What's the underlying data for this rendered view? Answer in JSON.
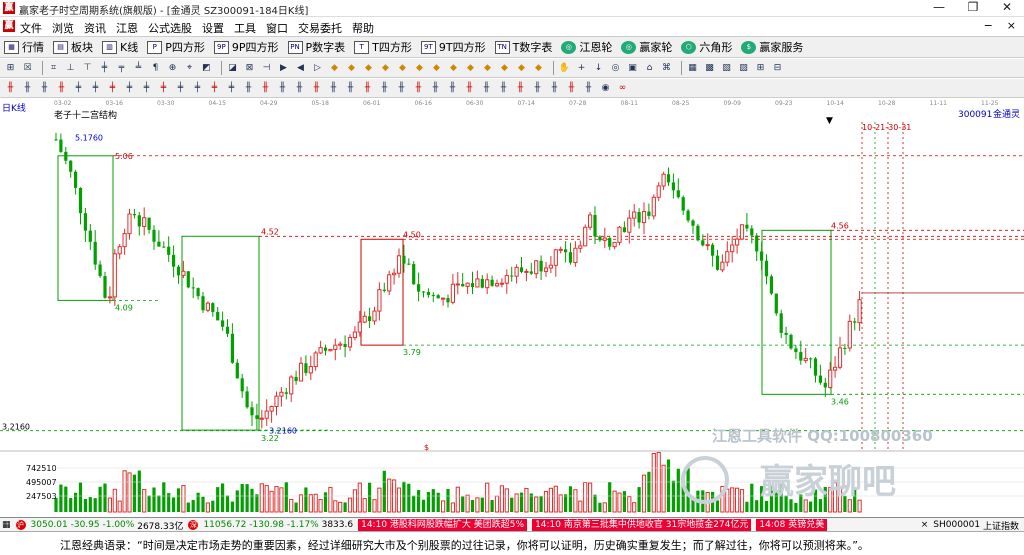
{
  "window": {
    "title": "赢家老子时空周期系统(旗舰版) - [金通灵  SZ300091-184日K线]",
    "logo": "赢",
    "controls": [
      "—",
      "❐",
      "✕"
    ]
  },
  "menubar": {
    "logo": "赢",
    "items": [
      "文件",
      "浏览",
      "资讯",
      "江恩",
      "公式选股",
      "设置",
      "工具",
      "窗口",
      "交易委托",
      "帮助"
    ],
    "right_controls": [
      "−",
      "×"
    ]
  },
  "toolbar1": [
    {
      "label": "行情",
      "icon": "grid-icon"
    },
    {
      "label": "板块",
      "icon": "blocks-icon"
    },
    {
      "label": "K线",
      "icon": "kline-icon"
    },
    {
      "label": "P四方形",
      "icon": "p-square-icon"
    },
    {
      "label": "9P四方形",
      "icon": "9p-square-icon"
    },
    {
      "label": "P数字表",
      "icon": "p-table-icon"
    },
    {
      "label": "T四方形",
      "icon": "t-square-icon"
    },
    {
      "label": "9T四方形",
      "icon": "9t-square-icon"
    },
    {
      "label": "T数字表",
      "icon": "t-table-icon"
    },
    {
      "label": "江恩轮",
      "icon": "gann-wheel-icon"
    },
    {
      "label": "赢家轮",
      "icon": "winner-wheel-icon"
    },
    {
      "label": "六角形",
      "icon": "hexagon-icon"
    },
    {
      "label": "赢家服务",
      "icon": "service-icon"
    }
  ],
  "chart_header": {
    "period_label": "日K线",
    "indicator_name": "老子十二宫结构",
    "symbol": "300091",
    "name": "金通灵",
    "watermark_line1": "江恩工具软件  QQ:100800360",
    "watermark_line2": "赢家聊吧"
  },
  "timeline_labels": [
    "03-02",
    "03-16",
    "03-30",
    "04-15",
    "04-29",
    "05-18",
    "06-01",
    "06-16",
    "06-30",
    "07-14",
    "07-28",
    "08-11",
    "08-25",
    "09-09",
    "09-23",
    "10-14",
    "10-28",
    "11-11",
    "11-25"
  ],
  "chart_data": {
    "type": "candlestick",
    "price_labels": {
      "start": "5.1760",
      "h1": "5.06",
      "l1": "4.09",
      "h2": "4.52",
      "low_price": "3.2160",
      "low_price2": "3.22",
      "h3": "4.50",
      "l3": "3.79",
      "h4": "4.56",
      "l4": "3.46",
      "right_axis_low": "3.2160",
      "future_dates": "10-21-30-31",
      "dollar_marker": "$"
    },
    "volume_axis": [
      "742510",
      "495007",
      "247503"
    ],
    "ylim": [
      3.1,
      5.3
    ]
  },
  "tabstrip": {
    "sh_icon": "沪",
    "sh_index": "3050.01",
    "sh_chg": "-30.95",
    "sh_pct": "-1.00%",
    "sh_amt": "2678.33亿",
    "sz_icon": "深",
    "sz_index": "11056.72",
    "sz_chg": "-130.98",
    "sz_pct": "-1.17%",
    "sz_amt": "3833.6",
    "news1_time": "14:10",
    "news1": "港股科网股跌幅扩大 美团跌超5%",
    "news2_time": "14:10",
    "news2": "南京第三批集中供地收官 31宗地揽金274亿元",
    "news3_time": "14:08",
    "news3": "英镑兑美",
    "right_symbol": "SH000001",
    "right_name": "上证指数"
  },
  "status": {
    "quote": "江恩经典语录：“时间是决定市场走势的重要因素，经过详细研究大市及个别股票的过往记录，你将可以证明，历史确实重复发生；而了解过往，你将可以预测将来。”。"
  },
  "colors": {
    "up": "#e03030",
    "down": "#00a000",
    "box_red": "#d00000",
    "box_green": "#00a000"
  }
}
